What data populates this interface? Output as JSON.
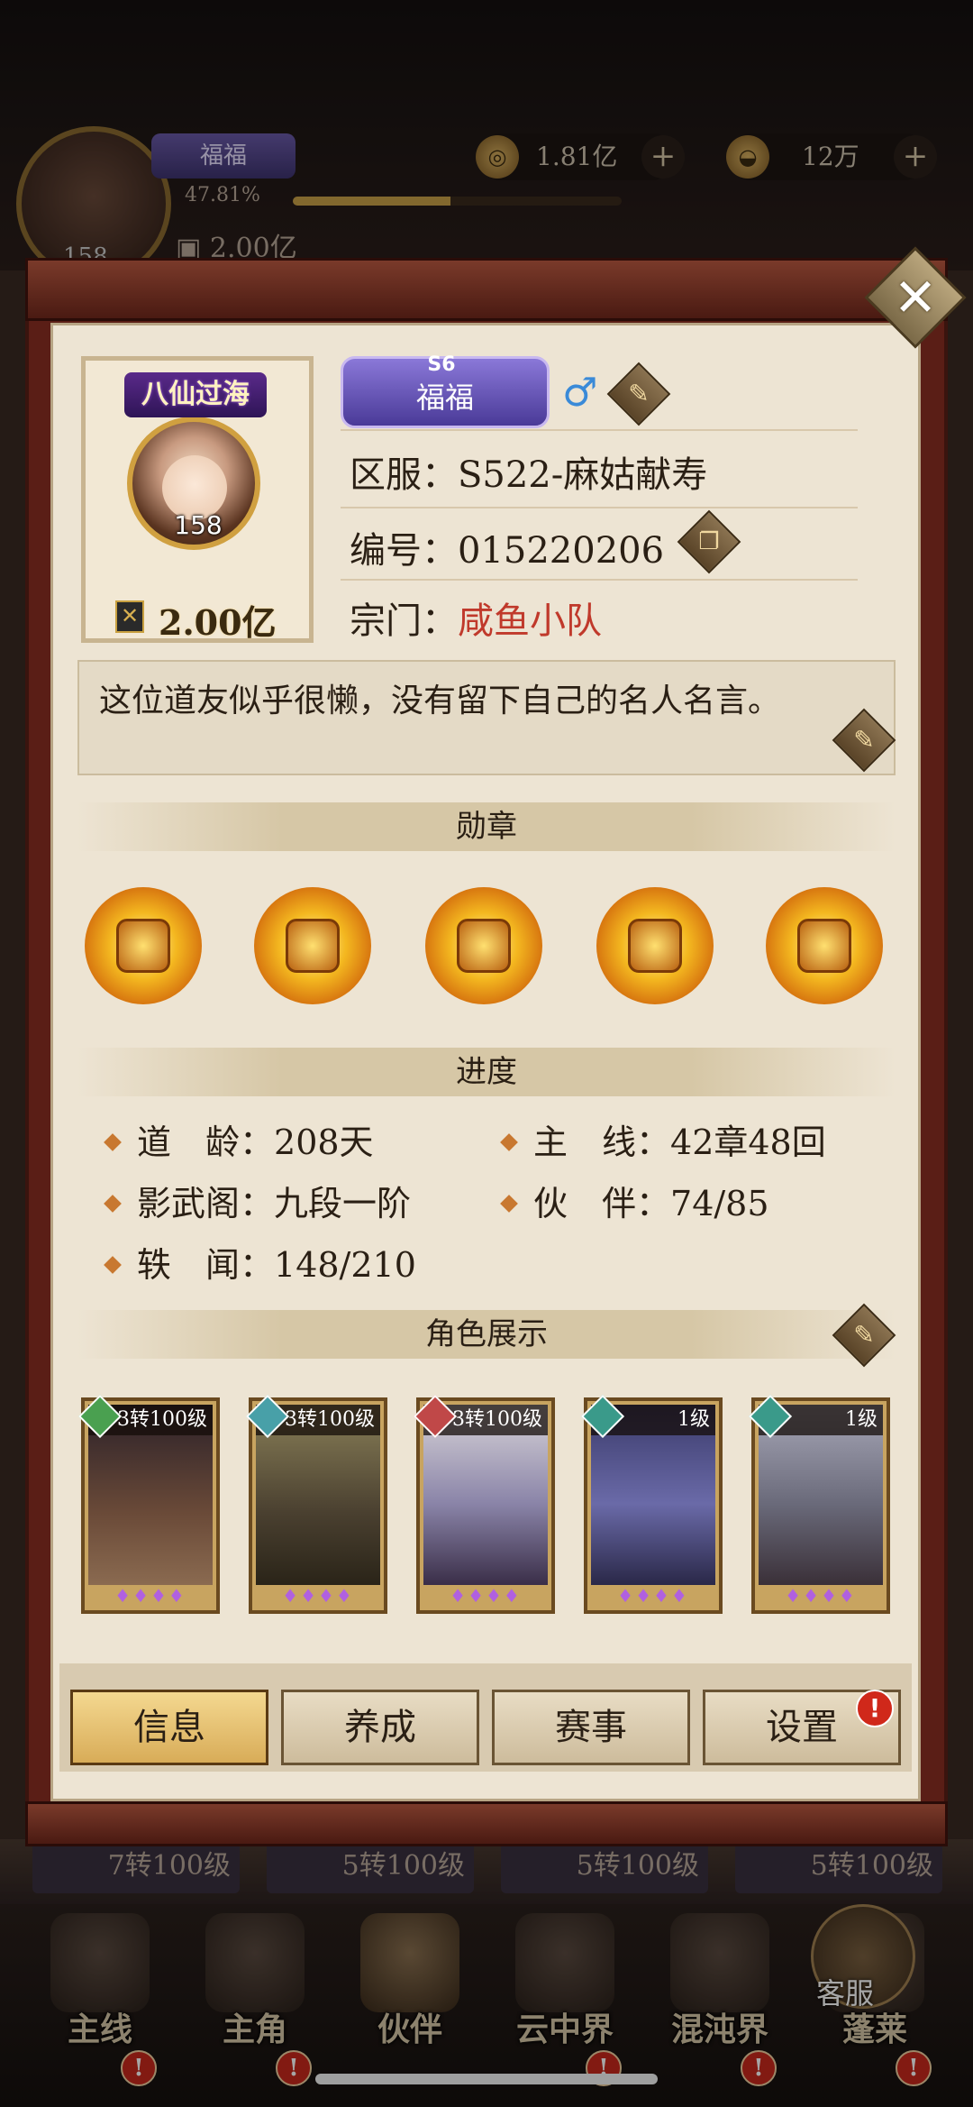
{
  "background": {
    "player_title": "福福",
    "exp_percent": "47.81%",
    "exp_fraction": 0.4781,
    "power": "2.00亿",
    "avatar_level": "158",
    "coins": "1.81亿",
    "gold": "12万",
    "strip_levels": [
      "7转100级",
      "5转100级",
      "5转100级",
      "5转100级"
    ]
  },
  "profile": {
    "title_ribbon": "八仙过海",
    "avatar_level": "158",
    "power": "2.00亿",
    "season_tag": "S6",
    "name": "福福",
    "gender_icon": "♂",
    "server_label": "区服：",
    "server_value": "S522-麻姑献寿",
    "id_label": "编号：",
    "id_value": "015220206",
    "sect_label": "宗门：",
    "sect_value": "咸鱼小队",
    "motto": "这位道友似乎很懒，没有留下自己的名人名言。"
  },
  "sections": {
    "medals": "勋章",
    "progress": "进度",
    "characters": "角色展示"
  },
  "progress": [
    {
      "label": "道　龄：",
      "value": "208天"
    },
    {
      "label": "主　线：",
      "value": "42章48回"
    },
    {
      "label": "影武阁：",
      "value": "九段一阶"
    },
    {
      "label": "伙　伴：",
      "value": "74/85"
    },
    {
      "label": "轶　闻：",
      "value": "148/210"
    }
  ],
  "characters": [
    {
      "level": "3转100级",
      "element_color": "#4aa050",
      "stars": "♦♦♦♦"
    },
    {
      "level": "3转100级",
      "element_color": "#48a0a8",
      "stars": "♦♦♦♦"
    },
    {
      "level": "3转100级",
      "element_color": "#c04848",
      "stars": "♦♦♦♦"
    },
    {
      "level": "1级",
      "element_color": "#3a9a8a",
      "stars": "♦♦♦♦"
    },
    {
      "level": "1级",
      "element_color": "#3a9a8a",
      "stars": "♦♦♦♦"
    }
  ],
  "tabs": [
    {
      "label": "信息",
      "active": true
    },
    {
      "label": "养成",
      "active": false
    },
    {
      "label": "赛事",
      "active": false
    },
    {
      "label": "设置",
      "active": false
    }
  ],
  "tab_badge": "!",
  "nav": [
    {
      "label": "主线",
      "badge": "!"
    },
    {
      "label": "主角",
      "badge": "!"
    },
    {
      "label": "伙伴",
      "badge": ""
    },
    {
      "label": "云中界",
      "badge": "!"
    },
    {
      "label": "混沌界",
      "badge": "!"
    },
    {
      "label": "蓬莱",
      "badge": "!"
    }
  ],
  "kefu_label": "客服",
  "colors": {
    "accent_gold": "#d8ac58",
    "sect_red": "#c0392b",
    "badge_red": "#d0281a"
  }
}
